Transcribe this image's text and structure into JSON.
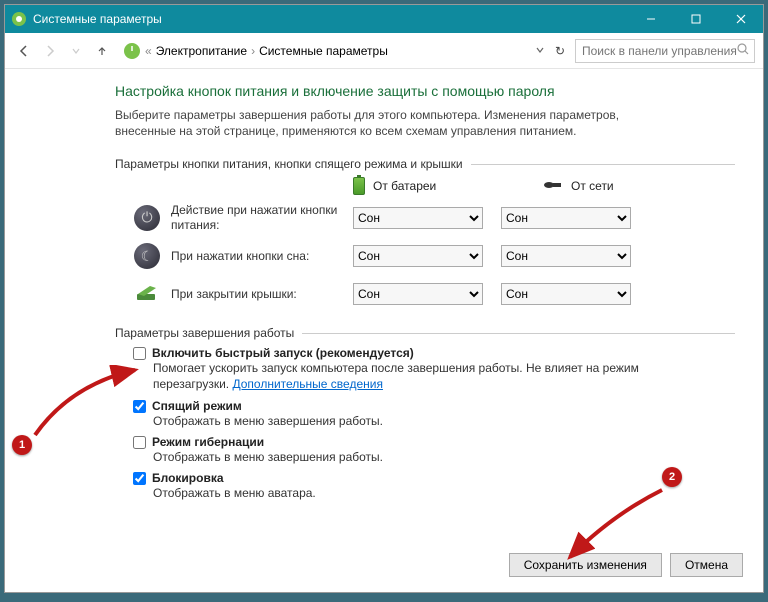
{
  "titlebar": {
    "title": "Системные параметры"
  },
  "breadcrumb": {
    "item1": "Электропитание",
    "item2": "Системные параметры"
  },
  "search": {
    "placeholder": "Поиск в панели управления"
  },
  "heading": "Настройка кнопок питания и включение защиты с помощью пароля",
  "subheading": "Выберите параметры завершения работы для этого компьютера. Изменения параметров, внесенные на этой странице, применяются ко всем схемам управления питанием.",
  "section1_title": "Параметры кнопки питания, кнопки спящего режима и крышки",
  "col_headers": {
    "battery": "От батареи",
    "plugged": "От сети"
  },
  "rows": {
    "power_btn": {
      "label": "Действие при нажатии кнопки питания:",
      "battery": "Сон",
      "plugged": "Сон"
    },
    "sleep_btn": {
      "label": "При нажатии кнопки сна:",
      "battery": "Сон",
      "plugged": "Сон"
    },
    "lid": {
      "label": "При закрытии крышки:",
      "battery": "Сон",
      "plugged": "Сон"
    }
  },
  "section2_title": "Параметры завершения работы",
  "checkboxes": {
    "fast_startup": {
      "label": "Включить быстрый запуск (рекомендуется)",
      "desc1": "Помогает ускорить запуск компьютера после завершения работы. Не влияет на режим перезагрузки. ",
      "link": "Дополнительные сведения",
      "checked": false
    },
    "sleep": {
      "label": "Спящий режим",
      "desc": "Отображать в меню завершения работы.",
      "checked": true
    },
    "hibernate": {
      "label": "Режим гибернации",
      "desc": "Отображать в меню завершения работы.",
      "checked": false
    },
    "lock": {
      "label": "Блокировка",
      "desc": "Отображать в меню аватара.",
      "checked": true
    }
  },
  "footer": {
    "save": "Сохранить изменения",
    "cancel": "Отмена"
  },
  "annotations": {
    "one": "1",
    "two": "2"
  }
}
